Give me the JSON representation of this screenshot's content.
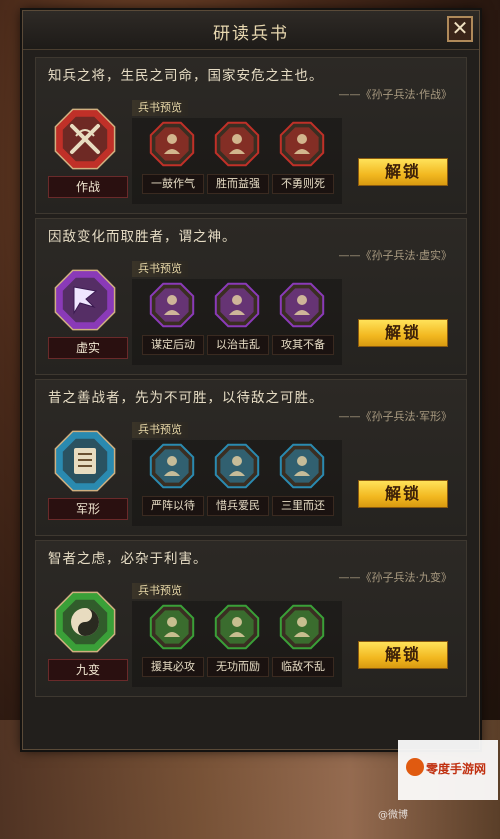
{
  "dialog": {
    "title": "研读兵书",
    "close_label": "✕"
  },
  "preview_label": "兵书预览",
  "unlock_label": "解锁",
  "books": [
    {
      "quote": "知兵之将，生民之司命，国家安危之主也。",
      "source": "——《孙子兵法·作战》",
      "name": "作战",
      "emblem_color": "#c03028",
      "emblem_icon": "crossed-swords-icon",
      "skills": [
        {
          "name": "一鼓作气",
          "icon": "war-drum-icon"
        },
        {
          "name": "胜而益强",
          "icon": "victory-general-icon"
        },
        {
          "name": "不勇则死",
          "icon": "brave-soldier-icon"
        }
      ]
    },
    {
      "quote": "因敌变化而取胜者，谓之神。",
      "source": "——《孙子兵法·虚实》",
      "name": "虚实",
      "emblem_color": "#8a3ab8",
      "emblem_icon": "lightning-flag-icon",
      "skills": [
        {
          "name": "谋定后动",
          "icon": "strategist-icon"
        },
        {
          "name": "以治击乱",
          "icon": "disciplined-strike-icon"
        },
        {
          "name": "攻其不备",
          "icon": "surprise-attack-icon"
        }
      ]
    },
    {
      "quote": "昔之善战者，先为不可胜，以待敌之可胜。",
      "source": "——《孙子兵法·军形》",
      "name": "军形",
      "emblem_color": "#2a8ab0",
      "emblem_icon": "formation-scroll-icon",
      "skills": [
        {
          "name": "严阵以待",
          "icon": "battle-formation-icon"
        },
        {
          "name": "惜兵爱民",
          "icon": "sprout-icon"
        },
        {
          "name": "三里而还",
          "icon": "retreat-icon"
        }
      ]
    },
    {
      "quote": "智者之虑，必杂于利害。",
      "source": "——《孙子兵法·九变》",
      "name": "九变",
      "emblem_color": "#3aa038",
      "emblem_icon": "yin-yang-icon",
      "skills": [
        {
          "name": "援其必攻",
          "icon": "reinforce-icon"
        },
        {
          "name": "无功而励",
          "icon": "encourage-icon"
        },
        {
          "name": "临敌不乱",
          "icon": "calm-commander-icon"
        }
      ]
    }
  ],
  "watermark": {
    "site": "零度手游网",
    "weibo": "@微博"
  }
}
